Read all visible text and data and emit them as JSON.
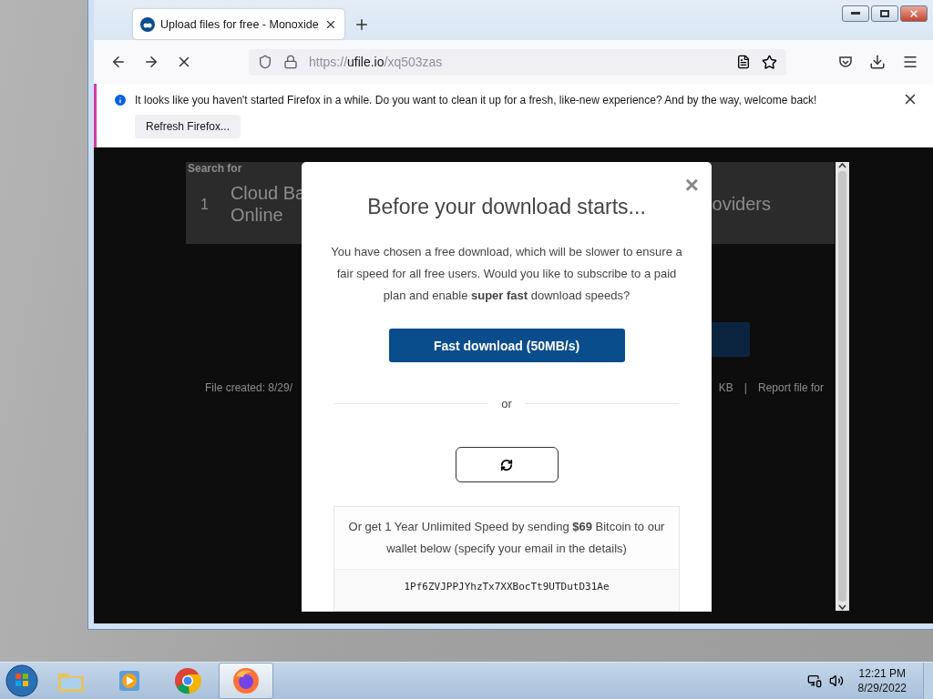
{
  "browser": {
    "tab": {
      "title": "Upload files for free - Monoxide",
      "selected": true
    },
    "url": {
      "scheme": "https://",
      "host": "ufile.io",
      "path": "/xq503zas"
    },
    "notification": {
      "text": "It looks like you haven't started Firefox in a while. Do you want to clean it up for a fresh, like-new experience? And by the way, welcome back!",
      "button": "Refresh Firefox..."
    }
  },
  "page_background": {
    "search_label": "Search for",
    "ad_number": "1",
    "ad_title_line_1": "Cloud Ba",
    "ad_title_line_2": "Online",
    "ad_right_text": "oviders",
    "file_created": "File created: 8/29/",
    "file_size": "KB",
    "separator": "|",
    "report_link": "Report file for"
  },
  "modal": {
    "close": "×",
    "title": "Before your download starts...",
    "message": "You have chosen a free download, which will be slower to ensure a fair speed for all free users. Would you like to subscribe to a paid plan and enable **super fast** download speeds?",
    "fast_button": "Fast download (50MB/s)",
    "divider": "or",
    "bitcoin_text": "Or get 1 Year Unlimited Speed by sending **$69** Bitcoin to our wallet below (specify your email in the details)",
    "wallet_address": "1Pf6ZVJPPJYhzTx7XXBocTt9UTDutD31Ae"
  },
  "taskbar": {
    "apps": [
      {
        "kind": "explorer",
        "selected": false
      },
      {
        "kind": "media",
        "selected": false
      },
      {
        "kind": "chrome",
        "selected": false
      },
      {
        "kind": "firefox",
        "selected": true
      }
    ],
    "time": "12:21 PM",
    "date": "8/29/2022"
  }
}
